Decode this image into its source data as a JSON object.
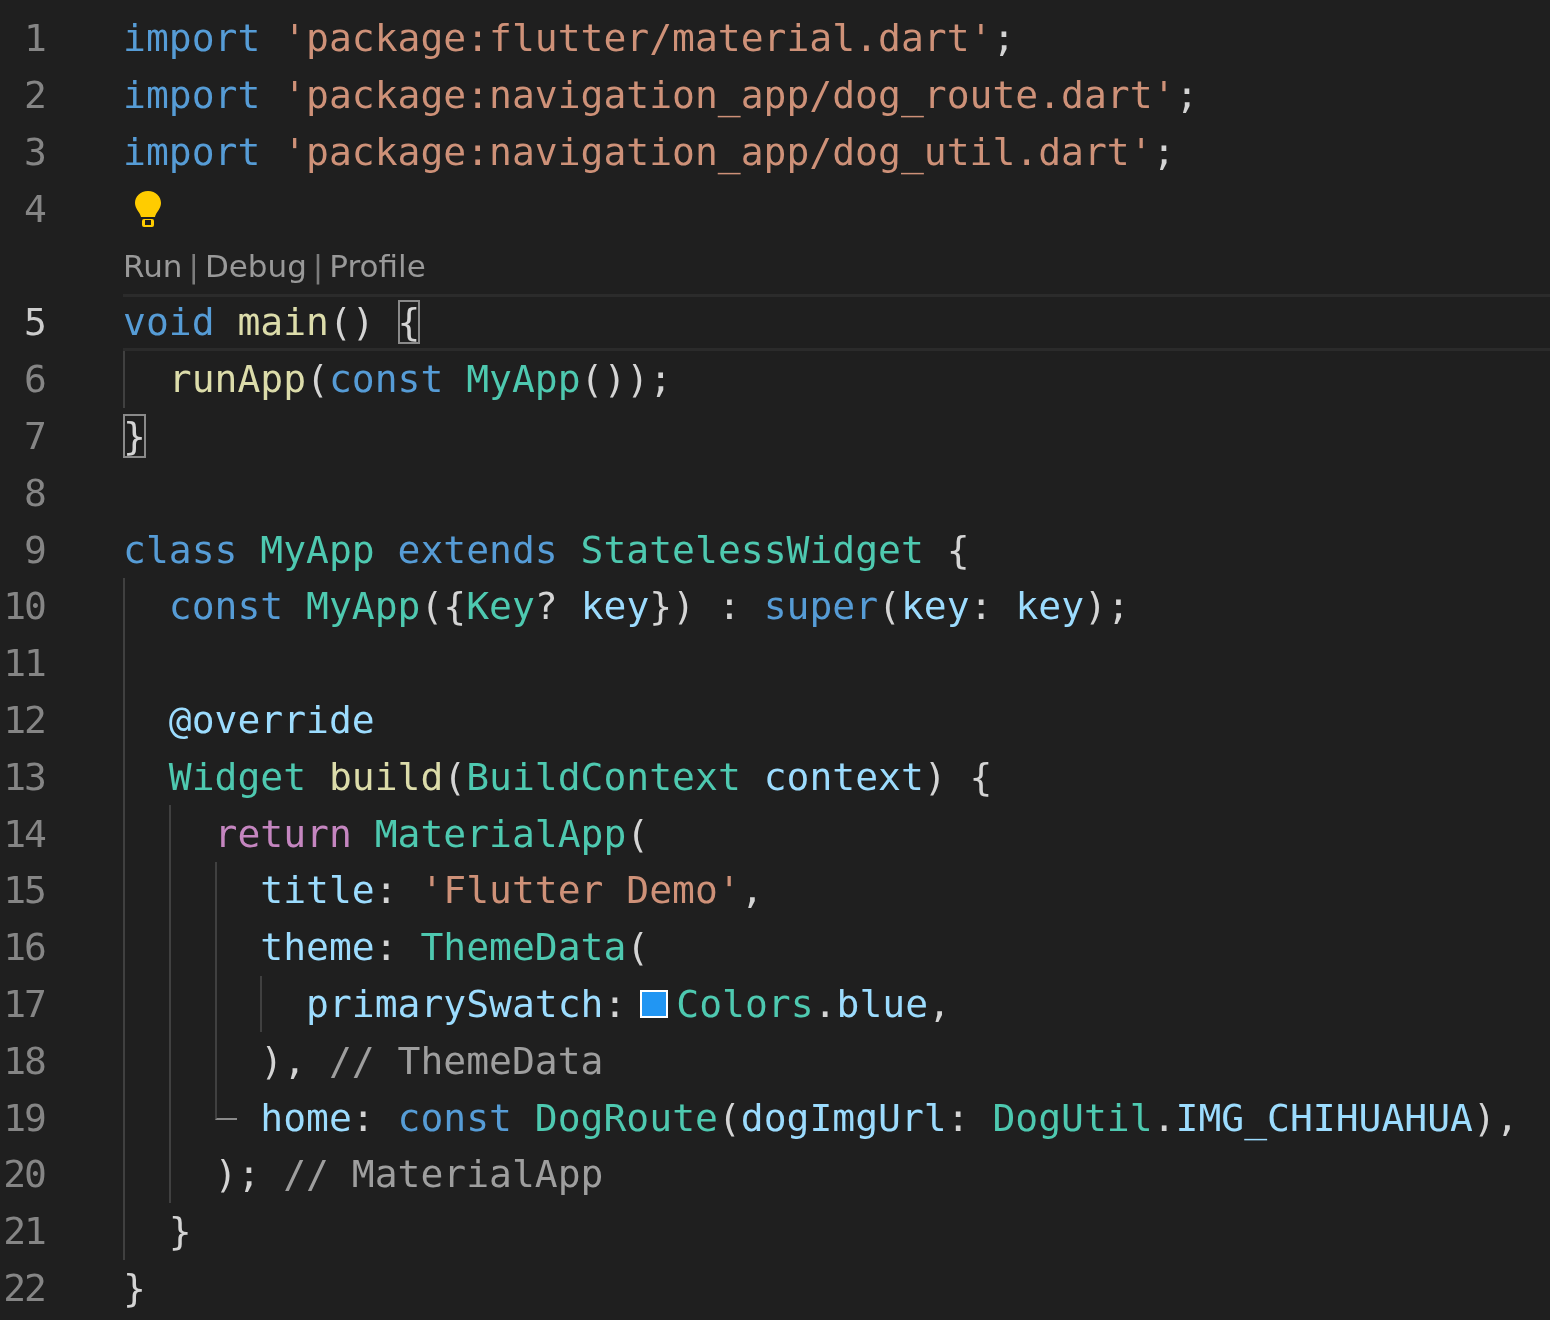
{
  "editor": {
    "lines": [
      {
        "number": "1",
        "tokens": [
          {
            "kind": "keyword",
            "text": "import"
          },
          {
            "kind": "string",
            "text": " 'package:flutter/material.dart'"
          },
          {
            "kind": "punct",
            "text": ";"
          }
        ]
      },
      {
        "number": "2",
        "tokens": [
          {
            "kind": "keyword",
            "text": "import"
          },
          {
            "kind": "string",
            "text": " 'package:navigation_app/dog_route.dart'"
          },
          {
            "kind": "punct",
            "text": ";"
          }
        ]
      },
      {
        "number": "3",
        "tokens": [
          {
            "kind": "keyword",
            "text": "import"
          },
          {
            "kind": "string",
            "text": " 'package:navigation_app/dog_util.dart'"
          },
          {
            "kind": "punct",
            "text": ";"
          }
        ]
      },
      {
        "number": "4",
        "lightbulb": true
      },
      {
        "kind": "codelens",
        "items": [
          {
            "kind": "link",
            "text": "Run"
          },
          {
            "kind": "separator",
            "text": "|"
          },
          {
            "kind": "link",
            "text": "Debug"
          },
          {
            "kind": "separator",
            "text": "|"
          },
          {
            "kind": "link",
            "text": "Profile"
          }
        ]
      },
      {
        "number": "5",
        "current": true,
        "tokens": [
          {
            "kind": "keyword",
            "text": "void"
          },
          {
            "kind": "function",
            "text": " main"
          },
          {
            "kind": "punct",
            "text": "()"
          },
          {
            "kind": "punct",
            "text": " {",
            "matched": true
          }
        ]
      },
      {
        "number": "6",
        "tokens": [
          {
            "kind": "function",
            "text": "  runApp"
          },
          {
            "kind": "punct",
            "text": "("
          },
          {
            "kind": "keyword",
            "text": "const"
          },
          {
            "kind": "class",
            "text": " MyApp"
          },
          {
            "kind": "punct",
            "text": "());"
          }
        ]
      },
      {
        "number": "7",
        "tokens": [
          {
            "kind": "punct",
            "text": "}",
            "matched": true
          }
        ]
      },
      {
        "number": "8"
      },
      {
        "number": "9",
        "tokens": [
          {
            "kind": "keyword",
            "text": "class"
          },
          {
            "kind": "class",
            "text": " MyApp"
          },
          {
            "kind": "keyword",
            "text": " extends"
          },
          {
            "kind": "class",
            "text": " StatelessWidget"
          },
          {
            "kind": "punct",
            "text": " {"
          }
        ]
      },
      {
        "number": "10",
        "tokens": [
          {
            "kind": "keyword",
            "text": "  const"
          },
          {
            "kind": "class",
            "text": " MyApp"
          },
          {
            "kind": "punct",
            "text": "({"
          },
          {
            "kind": "class",
            "text": "Key"
          },
          {
            "kind": "punct",
            "text": "?"
          },
          {
            "kind": "variable",
            "text": " key"
          },
          {
            "kind": "punct",
            "text": "})"
          },
          {
            "kind": "punct",
            "text": " :"
          },
          {
            "kind": "keyword",
            "text": " super"
          },
          {
            "kind": "punct",
            "text": "("
          },
          {
            "kind": "variable",
            "text": "key"
          },
          {
            "kind": "punct",
            "text": ":"
          },
          {
            "kind": "variable",
            "text": " key"
          },
          {
            "kind": "punct",
            "text": ");"
          }
        ]
      },
      {
        "number": "11"
      },
      {
        "number": "12",
        "tokens": [
          {
            "kind": "variable",
            "text": "  @override"
          }
        ]
      },
      {
        "number": "13",
        "tokens": [
          {
            "kind": "class",
            "text": "  Widget"
          },
          {
            "kind": "function",
            "text": " build"
          },
          {
            "kind": "punct",
            "text": "("
          },
          {
            "kind": "class",
            "text": "BuildContext"
          },
          {
            "kind": "variable",
            "text": " context"
          },
          {
            "kind": "punct",
            "text": ")"
          },
          {
            "kind": "punct",
            "text": " {"
          }
        ]
      },
      {
        "number": "14",
        "tokens": [
          {
            "kind": "control",
            "text": "    return"
          },
          {
            "kind": "class",
            "text": " MaterialApp"
          },
          {
            "kind": "punct",
            "text": "("
          }
        ]
      },
      {
        "number": "15",
        "tokens": [
          {
            "kind": "variable",
            "text": "      title"
          },
          {
            "kind": "punct",
            "text": ":"
          },
          {
            "kind": "string",
            "text": " 'Flutter Demo'"
          },
          {
            "kind": "punct",
            "text": ","
          }
        ]
      },
      {
        "number": "16",
        "tokens": [
          {
            "kind": "variable",
            "text": "      theme"
          },
          {
            "kind": "punct",
            "text": ":"
          },
          {
            "kind": "class",
            "text": " ThemeData"
          },
          {
            "kind": "punct",
            "text": "("
          }
        ]
      },
      {
        "number": "17",
        "tokens": [
          {
            "kind": "variable",
            "text": "        primarySwatch"
          },
          {
            "kind": "punct",
            "text": ":"
          },
          {
            "kind": "swatch",
            "color": "#2196f3"
          },
          {
            "kind": "class",
            "text": "Colors"
          },
          {
            "kind": "punct",
            "text": "."
          },
          {
            "kind": "variable",
            "text": "blue"
          },
          {
            "kind": "punct",
            "text": ","
          }
        ]
      },
      {
        "number": "18",
        "tokens": [
          {
            "kind": "punct",
            "text": "      ),"
          },
          {
            "kind": "comment",
            "text": " // ThemeData"
          }
        ]
      },
      {
        "number": "19",
        "corner": true,
        "tokens": [
          {
            "kind": "variable",
            "text": "      home"
          },
          {
            "kind": "punct",
            "text": ":"
          },
          {
            "kind": "keyword",
            "text": " const"
          },
          {
            "kind": "class",
            "text": " DogRoute"
          },
          {
            "kind": "punct",
            "text": "("
          },
          {
            "kind": "variable",
            "text": "dogImgUrl"
          },
          {
            "kind": "punct",
            "text": ":"
          },
          {
            "kind": "class",
            "text": " DogUtil"
          },
          {
            "kind": "punct",
            "text": "."
          },
          {
            "kind": "variable",
            "text": "IMG_CHIHUAHUA"
          },
          {
            "kind": "punct",
            "text": "),"
          }
        ]
      },
      {
        "number": "20",
        "tokens": [
          {
            "kind": "punct",
            "text": "    );"
          },
          {
            "kind": "comment",
            "text": " // MaterialApp"
          }
        ]
      },
      {
        "number": "21",
        "tokens": [
          {
            "kind": "punct",
            "text": "  }"
          }
        ]
      },
      {
        "number": "22",
        "tokens": [
          {
            "kind": "punct",
            "text": "}"
          }
        ]
      }
    ]
  }
}
